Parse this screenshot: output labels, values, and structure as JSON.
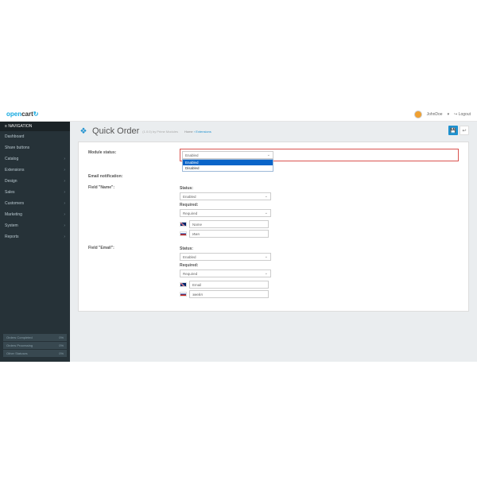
{
  "logo": {
    "part1": "open",
    "part2": "cart"
  },
  "user": {
    "name": "JohnDoe",
    "logout": "Logout"
  },
  "nav": {
    "header": "NAVIGATION",
    "items": [
      "Dashboard",
      "Share buttons",
      "Catalog",
      "Extensions",
      "Design",
      "Sales",
      "Customers",
      "Marketing",
      "System",
      "Reports"
    ],
    "subs": [
      false,
      false,
      true,
      true,
      true,
      true,
      true,
      true,
      true,
      true
    ]
  },
  "sidebarFooter": [
    {
      "label": "Orders Completed",
      "val": "0%"
    },
    {
      "label": "Orders Processing",
      "val": "0%"
    },
    {
      "label": "Other Statuses",
      "val": "0%"
    }
  ],
  "page": {
    "title": "Quick Order",
    "sub": "(1.0.0) by Prime Modules",
    "breadcrumb": {
      "home": "Home",
      "ext": "Extensions"
    }
  },
  "form": {
    "moduleStatus": {
      "label": "Module status:",
      "value": "Enabled",
      "options": [
        "Enabled",
        "Disabled"
      ]
    },
    "emailNotif": {
      "label": "Email notification:"
    },
    "statusLabel": "Status:",
    "statusValue": "Enabled",
    "requiredLabel": "Required:",
    "requiredValue": "Required",
    "fieldName": {
      "label": "Field \"Name\":",
      "en": "Name",
      "ru": "Имя"
    },
    "fieldEmail": {
      "label": "Field \"Email\":",
      "en": "Email",
      "ru": "эмейл"
    }
  }
}
